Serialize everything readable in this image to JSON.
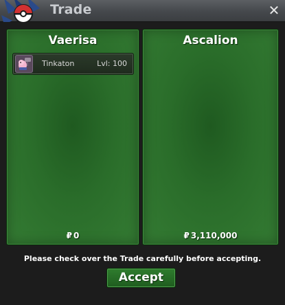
{
  "window": {
    "title": "Trade",
    "close_symbol": "✕"
  },
  "trade": {
    "left": {
      "name": "Vaerisa",
      "items": [
        {
          "name": "Tinkaton",
          "level": "Lvl: 100",
          "icon": "tinkaton-icon"
        }
      ],
      "money_symbol": "₽",
      "money": "0"
    },
    "right": {
      "name": "Ascalion",
      "items": [],
      "money_symbol": "₽",
      "money": "3,110,000"
    }
  },
  "notice": "Please check over the Trade carefully before accepting.",
  "accept_label": "Accept",
  "colors": {
    "panel_green": "#2a6d2a",
    "accept_green": "#2f7d2e",
    "titlebar": "#45484c"
  }
}
